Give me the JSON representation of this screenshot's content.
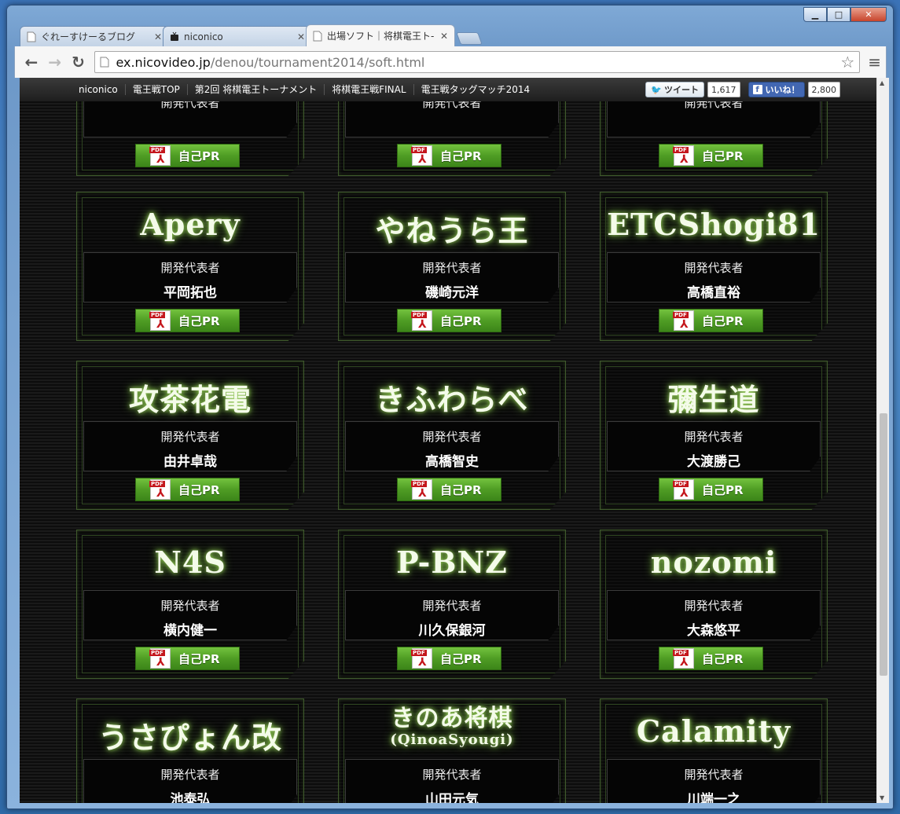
{
  "browser": {
    "tabs": [
      {
        "label": "ぐれーすけーるブログ"
      },
      {
        "label": "niconico"
      },
      {
        "label": "出場ソフト｜将棋電王ト-"
      }
    ],
    "url_domain": "ex.nicovideo.jp",
    "url_path": "/denou/tournament2014/soft.html",
    "window_minimize": "▁",
    "window_maximize": "□",
    "window_close": "✕"
  },
  "sitebar": {
    "links": [
      "niconico",
      "電王戦TOP",
      "第2回 将棋電王トーナメント",
      "将棋電王戦FINAL",
      "電王戦タッグマッチ2014"
    ],
    "tweet_label": "ツイート",
    "tweet_count": "1,617",
    "like_label": "いいね！",
    "like_count": "2,800"
  },
  "pr_label": "自己PR",
  "pdf_tag": "PDF",
  "dev_label": "開発代表者",
  "rows": [
    [
      {
        "name": "",
        "dev": ""
      },
      {
        "name": "",
        "dev": ""
      },
      {
        "name": "",
        "dev": ""
      }
    ],
    [
      {
        "name": "Apery",
        "dev": "平岡拓也"
      },
      {
        "name": "やねうら王",
        "dev": "磯崎元洋"
      },
      {
        "name": "ETCShogi81",
        "dev": "高橋直裕"
      }
    ],
    [
      {
        "name": "攻茶花電",
        "dev": "由井卓哉"
      },
      {
        "name": "きふわらべ",
        "dev": "高橋智史"
      },
      {
        "name": "彌生道",
        "dev": "大渡勝己"
      }
    ],
    [
      {
        "name": "N4S",
        "dev": "横内健一"
      },
      {
        "name": "P-BNZ",
        "dev": "川久保銀河"
      },
      {
        "name": "nozomi",
        "dev": "大森悠平"
      }
    ],
    [
      {
        "name": "うさぴょん改",
        "dev": "池泰弘"
      },
      {
        "name": "きのあ将棋",
        "sub": "(QinoaSyougi)",
        "dev": "山田元気"
      },
      {
        "name": "Calamity",
        "dev": "川端一之"
      }
    ]
  ]
}
